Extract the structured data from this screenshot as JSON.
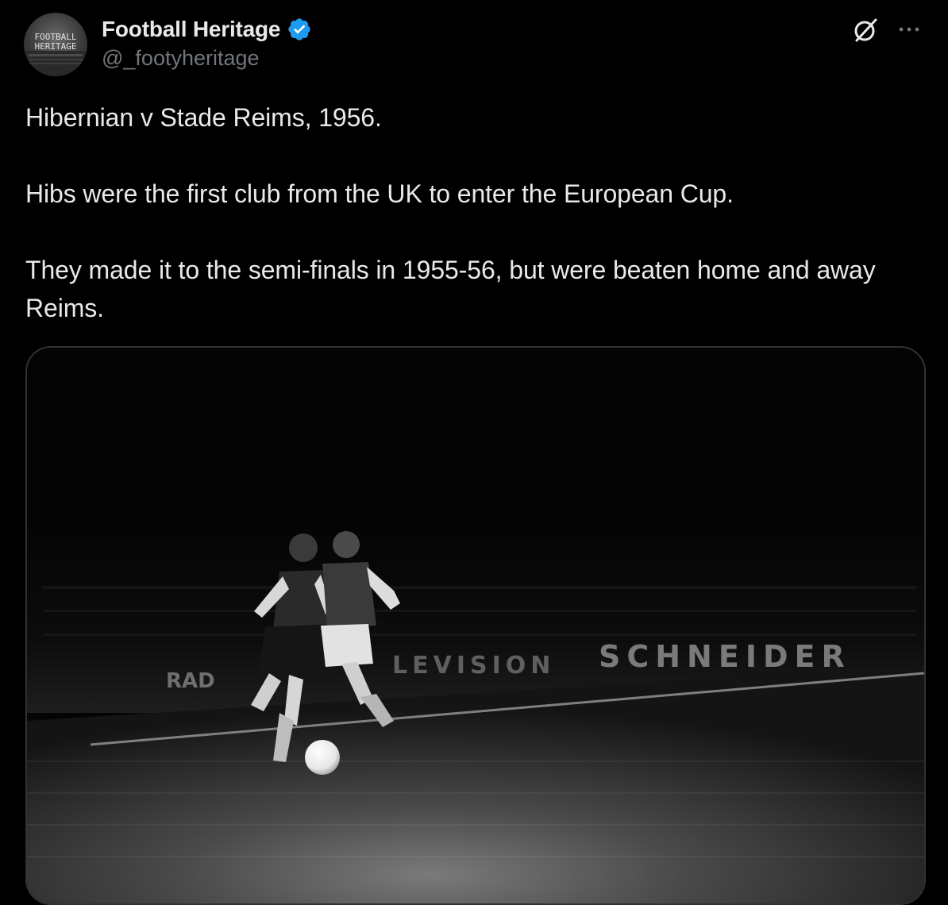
{
  "author": {
    "display_name": "Football Heritage",
    "handle": "@_footyheritage",
    "verified": true,
    "avatar_text_line1": "FOOTBALL",
    "avatar_text_line2": "HERITAGE"
  },
  "icons": {
    "verified": "verified-badge-icon",
    "grok": "grok-icon",
    "more": "more-options-icon"
  },
  "tweet": {
    "paragraphs": [
      "Hibernian v Stade Reims, 1956.",
      "Hibs were the first club from the UK to enter the European Cup.",
      "They made it to the semi-finals in 1955-56, but were beaten home and away Reims."
    ]
  },
  "media": {
    "type": "photo",
    "colors": "black-and-white",
    "signage_left": "RAD",
    "signage_middle": "LEVISION",
    "signage_right": "SCHNEIDER"
  },
  "colors": {
    "background": "#000000",
    "primary_text": "#e7e9ea",
    "secondary_text": "#71767b",
    "verified_blue": "#1d9bf0",
    "border": "#2f3336"
  }
}
